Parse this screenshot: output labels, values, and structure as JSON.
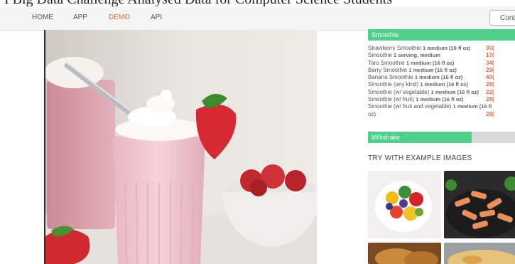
{
  "page_top_text": "I Big Data Challenge                      Analysed Data for Computer Science Students",
  "nav": {
    "home": "HOME",
    "app": "APP",
    "demo": "DEMO",
    "api": "API",
    "contact": "Conta"
  },
  "results": {
    "category_1": "Smoothie",
    "category_1_fill": 1.0,
    "items": [
      {
        "name": "Strawberry Smoothie",
        "serving": "1 medium (16 fl oz)",
        "cal": "30("
      },
      {
        "name": "Smoothie",
        "serving": "1 serving, medium",
        "cal": "17("
      },
      {
        "name": "Taro Smoothie",
        "serving": "1 medium (16 fl oz)",
        "cal": "34("
      },
      {
        "name": "Berry Smoothie",
        "serving": "1 medium (16 fl oz)",
        "cal": "29("
      },
      {
        "name": "Banana Smoothie",
        "serving": "1 medium (16 fl oz)",
        "cal": "40("
      },
      {
        "name": "Smoothie (any kind)",
        "serving": "1 medium (16 fl oz)",
        "cal": "28("
      },
      {
        "name": "Smoothie (w/ vegetable)",
        "serving": "1 medium (16 fl oz)",
        "cal": "22("
      },
      {
        "name": "Smoothie (w/ fruit)",
        "serving": "1 medium (16 fl oz)",
        "cal": "28("
      },
      {
        "name": "Smoothie (w/ fruit and vegetable)",
        "serving": "1 medium (16 fl",
        "cal": ""
      },
      {
        "name": "oz)",
        "serving": "",
        "cal": "28("
      }
    ],
    "category_2": "Milkshake",
    "category_2_fill": 0.68
  },
  "examples": {
    "title": "TRY WITH EXAMPLE IMAGES",
    "images": [
      "fruit-salad-bowl",
      "penne-pasta-plate",
      "fried-chicken",
      "baked-dish"
    ]
  },
  "colors": {
    "accent": "#f0673b",
    "bar_green": "#4fcf8a"
  }
}
